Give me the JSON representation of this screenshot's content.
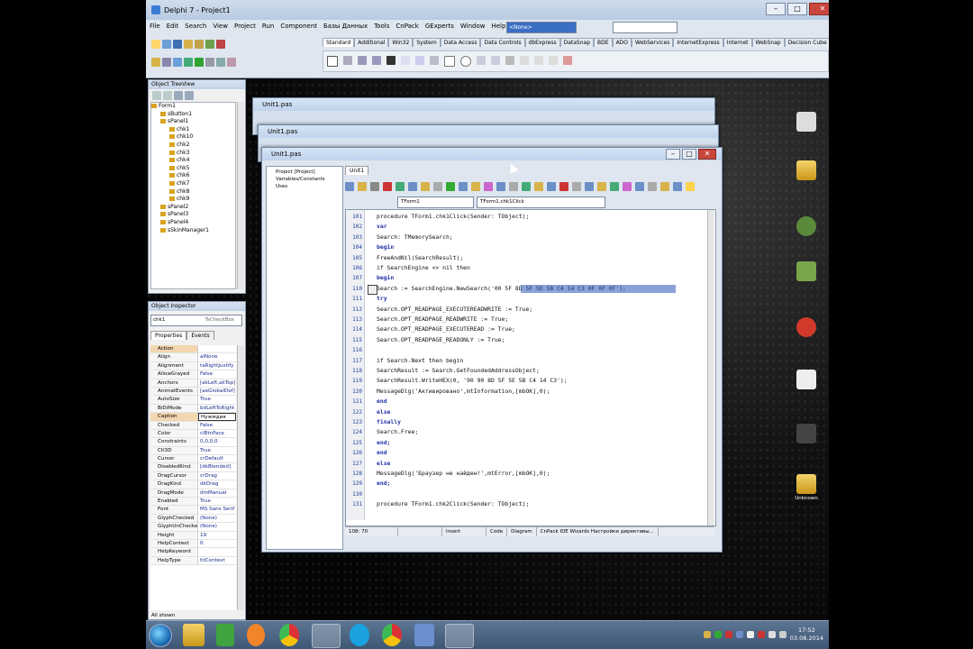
{
  "ide": {
    "title": "Delphi 7 - Project1",
    "menu": [
      "File",
      "Edit",
      "Search",
      "View",
      "Project",
      "Run",
      "Component",
      "Базы Данных",
      "Tools",
      "CnPack",
      "GExperts",
      "Window",
      "Help"
    ],
    "combo_value": "<None>",
    "palette_tabs": [
      "Standard",
      "Additional",
      "Win32",
      "System",
      "Data Access",
      "Data Controls",
      "dbExpress",
      "DataSnap",
      "BDE",
      "ADO",
      "WebServices",
      "InternetExpress",
      "Internet",
      "WebSnap",
      "Decision Cube"
    ]
  },
  "object_treeview": {
    "title": "Object TreeView",
    "items": [
      "Form1",
      "sButton1",
      "sPanel1",
      "chk1",
      "chk10",
      "chk2",
      "chk3",
      "chk4",
      "chk5",
      "chk6",
      "chk7",
      "chk8",
      "chk9",
      "sPanel2",
      "sPanel3",
      "sPanel4",
      "sSkinManager1"
    ]
  },
  "object_inspector": {
    "title": "Object Inspector",
    "selected": "chk1",
    "selected_type": "TsCheckBox",
    "tabs": [
      "Properties",
      "Events"
    ],
    "footer": "All shown",
    "rows": [
      {
        "k": "Action",
        "v": ""
      },
      {
        "k": "Align",
        "v": "alNone"
      },
      {
        "k": "Alignment",
        "v": "taRightJustify"
      },
      {
        "k": "AllowGrayed",
        "v": "False"
      },
      {
        "k": "Anchors",
        "v": "[akLeft,akTop]"
      },
      {
        "k": "AnimatEvents",
        "v": "[aeGlobalDef]"
      },
      {
        "k": "AutoSize",
        "v": "True"
      },
      {
        "k": "BiDiMode",
        "v": "bdLeftToRight"
      },
      {
        "k": "Caption",
        "v": "Нужмдия"
      },
      {
        "k": "Checked",
        "v": "False"
      },
      {
        "k": "Color",
        "v": "clBtnFace"
      },
      {
        "k": "Constraints",
        "v": "0,0,0,0"
      },
      {
        "k": "Ctl3D",
        "v": "True"
      },
      {
        "k": "Cursor",
        "v": "crDefault"
      },
      {
        "k": "DisabledKind",
        "v": "[dkBlended]"
      },
      {
        "k": "DragCursor",
        "v": "crDrag"
      },
      {
        "k": "DragKind",
        "v": "dkDrag"
      },
      {
        "k": "DragMode",
        "v": "dmManual"
      },
      {
        "k": "Enabled",
        "v": "True"
      },
      {
        "k": "Font",
        "v": "MS Sans Serif"
      },
      {
        "k": "GlyphChecked",
        "v": "(None)"
      },
      {
        "k": "GlyphUnChecked",
        "v": "(None)"
      },
      {
        "k": "Height",
        "v": "19"
      },
      {
        "k": "HelpContext",
        "v": "0"
      },
      {
        "k": "HelpKeyword",
        "v": ""
      },
      {
        "k": "HelpType",
        "v": "htContext"
      }
    ]
  },
  "back_windows": [
    "Unit1.pas",
    "Unit1.pas"
  ],
  "editor_window": {
    "title": "Unit1.pas",
    "tab": "Unit1",
    "explorer": [
      "Project [Project]",
      "Variables/Constants",
      "Uses"
    ],
    "class_combo": "TForm1",
    "method_combo": "TForm1.chk1Click",
    "lines": [
      {
        "n": "101",
        "t": "procedure TForm1.chk1Click(Sender: TObject);"
      },
      {
        "n": "102",
        "t": "var"
      },
      {
        "n": "103",
        "t": "Search: TMemorySearch;"
      },
      {
        "n": "104",
        "t": "begin"
      },
      {
        "n": "105",
        "t": "FreeAndNil(SearchResult);"
      },
      {
        "n": "106",
        "t": "if SearchEngine <> nil then"
      },
      {
        "n": "107",
        "t": "begin"
      },
      {
        "n": "110",
        "t": "Search := SearchEngine.NewSearch('00 5F 8D 5F 5E 5B C4 14 C3 0F 0F 0F');"
      },
      {
        "n": "111",
        "t": "try"
      },
      {
        "n": "112",
        "t": "Search.OPT_READPAGE_EXECUTEREADWRITE := True;"
      },
      {
        "n": "113",
        "t": "Search.OPT_READPAGE_READWRITE := True;"
      },
      {
        "n": "114",
        "t": "Search.OPT_READPAGE_EXECUTEREAD := True;"
      },
      {
        "n": "115",
        "t": "Search.OPT_READPAGE_READONLY := True;"
      },
      {
        "n": "116",
        "t": ""
      },
      {
        "n": "117",
        "t": "if Search.Next then begin"
      },
      {
        "n": "118",
        "t": "SearchResult := Search.GetFoundedAddressObject;"
      },
      {
        "n": "119",
        "t": "SearchResult.WriteHEX(0, '90 90 8D 5F 5E 5B C4 14 C3');"
      },
      {
        "n": "120",
        "t": "MessageDlg('Активировано',mtInformation,[mbOK],0);"
      },
      {
        "n": "121",
        "t": "end"
      },
      {
        "n": "122",
        "t": "else"
      },
      {
        "n": "123",
        "t": "finally"
      },
      {
        "n": "124",
        "t": "Search.Free;"
      },
      {
        "n": "125",
        "t": "end;"
      },
      {
        "n": "126",
        "t": "end"
      },
      {
        "n": "127",
        "t": "else"
      },
      {
        "n": "128",
        "t": "MessageDlg('Браузер не найден!',mtError,[mbOK],0);"
      },
      {
        "n": "129",
        "t": "end;"
      },
      {
        "n": "130",
        "t": ""
      },
      {
        "n": "131",
        "t": "procedure TForm1.chk2Click(Sender: TObject);"
      }
    ],
    "status": {
      "pos": "108: 70",
      "mode": "Insert",
      "tabs": [
        "Code",
        "Diagram"
      ],
      "msg": "CnPack IDE Wizards Настройки директивы..."
    }
  },
  "desktop": {
    "labels": [
      "",
      "",
      "",
      "",
      "",
      "",
      "",
      "Unknown"
    ]
  },
  "taskbar": {
    "time": "17:52",
    "date": "03.08.2014"
  }
}
